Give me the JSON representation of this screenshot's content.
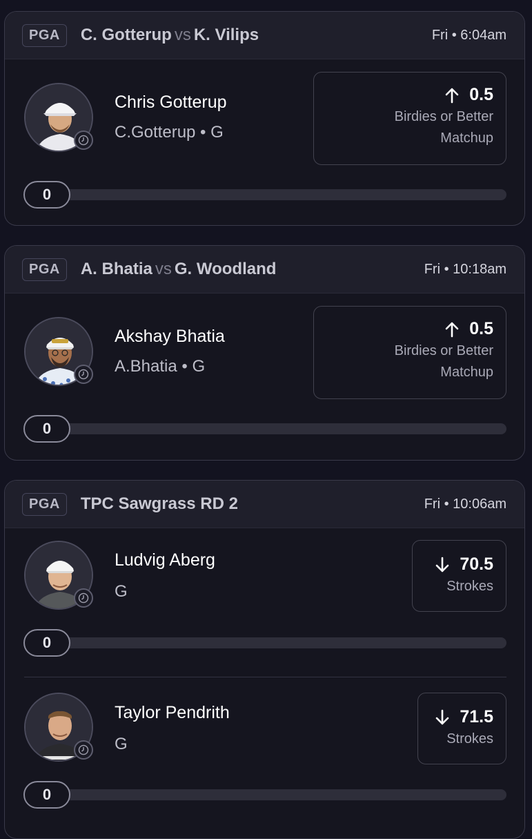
{
  "cards": [
    {
      "league": "PGA",
      "title_left": "C. Gotterup",
      "title_vs": "vs",
      "title_right": "K. Vilips",
      "time": "Fri • 6:04am",
      "players": [
        {
          "name": "Chris Gotterup",
          "sub": "C.Gotterup • G",
          "direction": "up",
          "line": "0.5",
          "stat_line1": "Birdies or Better",
          "stat_line2": "Matchup",
          "progress": "0"
        }
      ]
    },
    {
      "league": "PGA",
      "title_left": "A. Bhatia",
      "title_vs": "vs",
      "title_right": "G. Woodland",
      "time": "Fri • 10:18am",
      "players": [
        {
          "name": "Akshay Bhatia",
          "sub": "A.Bhatia • G",
          "direction": "up",
          "line": "0.5",
          "stat_line1": "Birdies or Better",
          "stat_line2": "Matchup",
          "progress": "0"
        }
      ]
    },
    {
      "league": "PGA",
      "title": "TPC Sawgrass RD 2",
      "time": "Fri • 10:06am",
      "players": [
        {
          "name": "Ludvig Aberg",
          "sub": "G",
          "direction": "down",
          "line": "70.5",
          "stat_line1": "Strokes",
          "progress": "0"
        },
        {
          "name": "Taylor Pendrith",
          "sub": "G",
          "direction": "down",
          "line": "71.5",
          "stat_line1": "Strokes",
          "progress": "0"
        }
      ]
    }
  ],
  "icons": {
    "up": "arrow-up-icon",
    "down": "arrow-down-icon",
    "clock": "clock-icon"
  },
  "colors": {
    "background": "#131320",
    "card": "#15151f",
    "header": "#1f1f2b",
    "border": "#3a3a4a",
    "progress_track": "#2e2e3a"
  }
}
